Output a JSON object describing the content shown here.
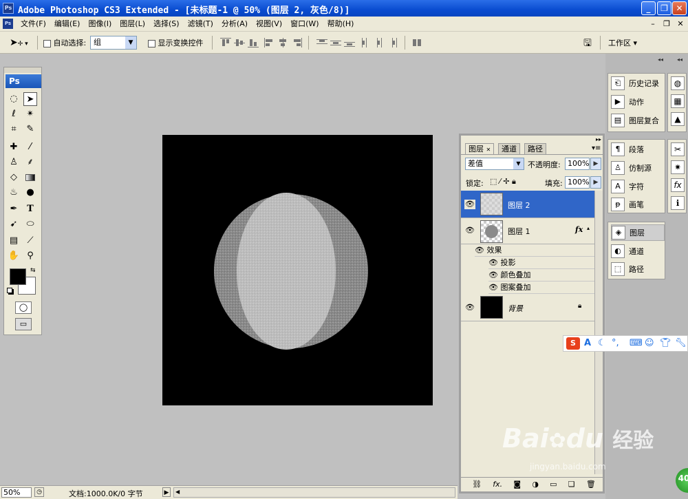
{
  "window": {
    "title": "Adobe Photoshop CS3 Extended - [未标题-1 @ 50% (图层 2, 灰色/8)]",
    "app_icon": "Ps",
    "min_label": "_",
    "max_label": "❐",
    "close_label": "✕"
  },
  "menu": {
    "items": [
      "文件(F)",
      "编辑(E)",
      "图像(I)",
      "图层(L)",
      "选择(S)",
      "滤镜(T)",
      "分析(A)",
      "视图(V)",
      "窗口(W)",
      "帮助(H)"
    ],
    "doc_min": "–",
    "doc_restore": "❐",
    "doc_close": "✕"
  },
  "options": {
    "auto_select_label": "自动选择:",
    "auto_select_value": "组",
    "show_transform_label": "显示变换控件",
    "workspace_label": "工作区"
  },
  "toolbox": {
    "title": "Ps"
  },
  "dock": {
    "group1": [
      "历史记录",
      "动作",
      "图层复合"
    ],
    "group2": [
      "段落",
      "仿制源",
      "字符",
      "画笔"
    ],
    "group3": [
      "图层",
      "通道",
      "路径"
    ]
  },
  "layers_panel": {
    "tabs": [
      "图层",
      "通道",
      "路径"
    ],
    "tab_close": "✕",
    "blend_mode": "差值",
    "opacity_label": "不透明度:",
    "opacity_value": "100%",
    "lock_label": "锁定:",
    "fill_label": "填充:",
    "fill_value": "100%",
    "layers": [
      {
        "name": "图层 2",
        "selected": true
      },
      {
        "name": "图层 1",
        "selected": false,
        "fx": "fx"
      },
      {
        "name": "背景",
        "selected": false
      }
    ],
    "effects_label": "效果",
    "effects": [
      "投影",
      "颜色叠加",
      "图案叠加"
    ],
    "footer_fx": "fx."
  },
  "status": {
    "zoom": "50%",
    "doc_info": "文档:1000.0K/0 字节"
  },
  "watermark": {
    "brand": "Bai",
    "brand2": "du",
    "cn": "经验",
    "url": "jingyan.baidu.com"
  },
  "badge": "40",
  "colors": {
    "title_blue": "#0a4cd0",
    "selection_blue": "#3066c8",
    "canvas_bg": "#000000",
    "workspace_gray": "#c0c0c0"
  }
}
